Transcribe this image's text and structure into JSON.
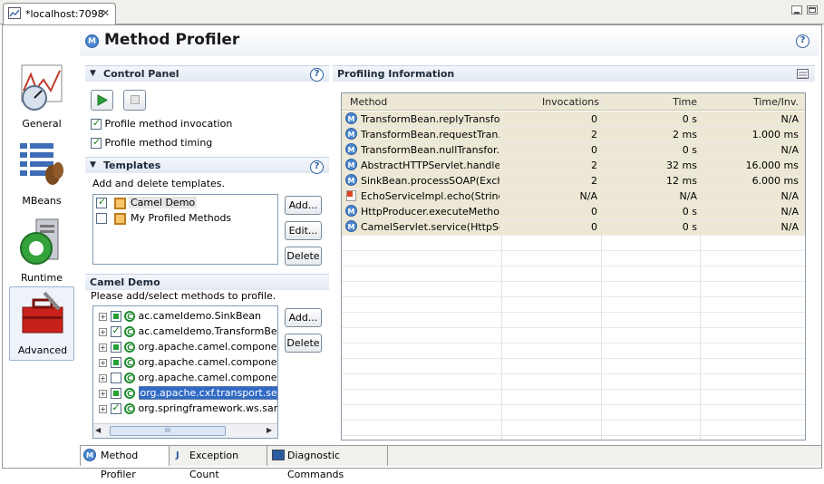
{
  "editor_tab": {
    "title": "*localhost:7098"
  },
  "header": {
    "title": "Method Profiler"
  },
  "leftnav": {
    "items": [
      "General",
      "MBeans",
      "Runtime",
      "Advanced"
    ]
  },
  "control_panel": {
    "title": "Control Panel",
    "checkboxes": [
      {
        "label": "Profile method invocation",
        "checked": true
      },
      {
        "label": "Profile method timing",
        "checked": true
      }
    ]
  },
  "templates": {
    "title": "Templates",
    "description": "Add and delete templates.",
    "items": [
      {
        "label": "Camel Demo",
        "checked": true,
        "selected": true
      },
      {
        "label": "My Profiled Methods",
        "checked": false,
        "selected": false
      }
    ],
    "add_label": "Add...",
    "edit_label": "Edit...",
    "delete_label": "Delete"
  },
  "camel_demo": {
    "title": "Camel Demo",
    "description": "Please add/select methods to profile.",
    "items": [
      {
        "label": "ac.cameldemo.SinkBean",
        "state": "partial"
      },
      {
        "label": "ac.cameldemo.TransformBean",
        "state": "checked"
      },
      {
        "label": "org.apache.camel.component",
        "state": "partial"
      },
      {
        "label": "org.apache.camel.component",
        "state": "partial"
      },
      {
        "label": "org.apache.camel.component",
        "state": "unchecked"
      },
      {
        "label": "org.apache.cxf.transport.serv",
        "state": "partial",
        "selected": true
      },
      {
        "label": "org.springframework.ws.samp",
        "state": "checked"
      }
    ],
    "add_label": "Add...",
    "delete_label": "Delete",
    "scrollbar_thumb": "III"
  },
  "profiling": {
    "title": "Profiling Information",
    "columns": [
      "Method",
      "Invocations",
      "Time",
      "Time/Inv."
    ],
    "rows": [
      {
        "icon": "m",
        "method": "TransformBean.replyTransfo...",
        "invocations": "0",
        "time": "0 s",
        "time_inv": "N/A"
      },
      {
        "icon": "m",
        "method": "TransformBean.requestTran...",
        "invocations": "2",
        "time": "2 ms",
        "time_inv": "1.000 ms"
      },
      {
        "icon": "m",
        "method": "TransformBean.nullTransfor...",
        "invocations": "0",
        "time": "0 s",
        "time_inv": "N/A"
      },
      {
        "icon": "m",
        "method": "AbstractHTTPServlet.handle...",
        "invocations": "2",
        "time": "32 ms",
        "time_inv": "16.000 ms"
      },
      {
        "icon": "m",
        "method": "SinkBean.processSOAP(Exch...",
        "invocations": "2",
        "time": "12 ms",
        "time_inv": "6.000 ms"
      },
      {
        "icon": "error",
        "method": "EchoServiceImpl.echo(String)",
        "invocations": "N/A",
        "time": "N/A",
        "time_inv": "N/A"
      },
      {
        "icon": "m",
        "method": "HttpProducer.executeMetho...",
        "invocations": "0",
        "time": "0 s",
        "time_inv": "N/A"
      },
      {
        "icon": "m",
        "method": "CamelServlet.service(HttpSe...",
        "invocations": "0",
        "time": "0 s",
        "time_inv": "N/A"
      }
    ]
  },
  "bottom_tabs": [
    {
      "label": "Method Profiler",
      "active": true
    },
    {
      "label": "Exception Count",
      "active": false
    },
    {
      "label": "Diagnostic Commands",
      "active": false
    }
  ],
  "colors": {
    "row_highlight": "#ede8d5",
    "selection": "#316ac5",
    "accent": "#2a5ca0"
  }
}
